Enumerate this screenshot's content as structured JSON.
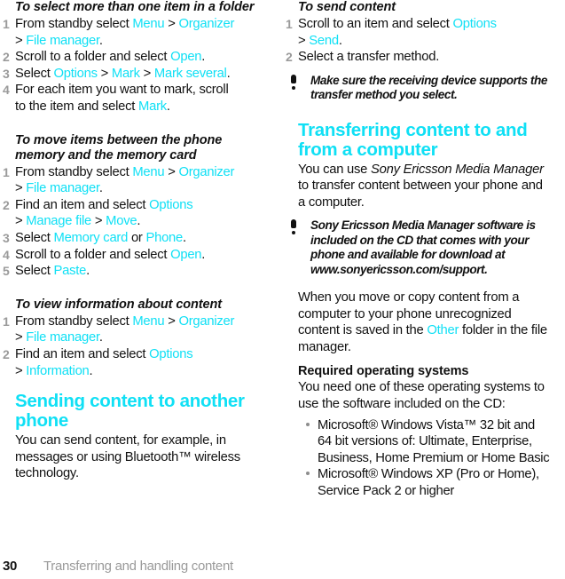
{
  "colors": {
    "accent_cyan": "#10E0F5",
    "step_number_gray": "#9a9a9a",
    "footer_gray": "#9a9a9a",
    "body_black": "#111111"
  },
  "left_column": {
    "proc1": {
      "title": "To select more than one item in a folder",
      "steps": [
        {
          "num": "1",
          "line1_pre": "From standby select ",
          "kw1": "Menu",
          "sep1": " > ",
          "kw2": "Organizer",
          "line2_sep": "> ",
          "kw3": "File manager",
          "line2_end": "."
        },
        {
          "num": "2",
          "pre": "Scroll to a folder and select ",
          "kw1": "Open",
          "end": "."
        },
        {
          "num": "3",
          "pre": "Select ",
          "kw1": "Options",
          "sep1": " > ",
          "kw2": "Mark",
          "sep2": " > ",
          "kw3": "Mark several",
          "end": "."
        },
        {
          "num": "4",
          "line1": "For each item you want to mark, scroll",
          "line2_pre": "to the item and select ",
          "kw1": "Mark",
          "end": "."
        }
      ]
    },
    "proc2": {
      "title": "To move items between the phone memory and the memory card",
      "steps": [
        {
          "num": "1",
          "line1_pre": "From standby select ",
          "kw1": "Menu",
          "sep1": " > ",
          "kw2": "Organizer",
          "line2_sep": "> ",
          "kw3": "File manager",
          "line2_end": "."
        },
        {
          "num": "2",
          "line1_pre": "Find an item and select ",
          "kw1": "Options",
          "line2_sep": "> ",
          "kw2": "Manage file",
          "sep2": " > ",
          "kw3": "Move",
          "line2_end": "."
        },
        {
          "num": "3",
          "pre": "Select ",
          "kw1": "Memory card",
          "sep1": " or ",
          "kw2": "Phone",
          "end": "."
        },
        {
          "num": "4",
          "pre": "Scroll to a folder and select ",
          "kw1": "Open",
          "end": "."
        },
        {
          "num": "5",
          "pre": "Select ",
          "kw1": "Paste",
          "end": "."
        }
      ]
    },
    "proc3": {
      "title": "To view information about content",
      "steps": [
        {
          "num": "1",
          "line1_pre": "From standby select ",
          "kw1": "Menu",
          "sep1": " > ",
          "kw2": "Organizer",
          "line2_sep": "> ",
          "kw3": "File manager",
          "line2_end": "."
        },
        {
          "num": "2",
          "line1_pre": "Find an item and select ",
          "kw1": "Options",
          "line2_sep": "> ",
          "kw2": "Information",
          "line2_end": "."
        }
      ]
    },
    "section": {
      "heading": "Sending content to another phone",
      "body": "You can send content, for example, in messages or using Bluetooth™ wireless technology."
    }
  },
  "right_column": {
    "proc1": {
      "title": "To send content",
      "steps": [
        {
          "num": "1",
          "line1_pre": "Scroll to an item and select ",
          "kw1": "Options",
          "line2_sep": "> ",
          "kw2": "Send",
          "line2_end": "."
        },
        {
          "num": "2",
          "pre": "Select a transfer method.",
          "kw1": "",
          "end": ""
        }
      ]
    },
    "tip1": {
      "icon": "exclamation-icon",
      "text": "Make sure the receiving device supports the transfer method you select."
    },
    "section": {
      "heading": "Transferring content to and from a computer",
      "body_pre": "You can use ",
      "body_italic": "Sony Ericsson Media Manager",
      "body_post": " to transfer content between your phone and a computer."
    },
    "tip2": {
      "icon": "exclamation-icon",
      "text": "Sony Ericsson Media Manager software is included on the CD that comes with your phone and available for download at www.sonyericsson.com/support."
    },
    "para_other": {
      "pre": "When you move or copy content from a computer to your phone unrecognized content is saved in the ",
      "kw": "Other",
      "post": " folder in the file manager."
    },
    "subsection": {
      "heading": "Required operating systems",
      "body": "You need one of these operating systems to use the software included on the CD:",
      "bullets": [
        "Microsoft® Windows Vista™ 32 bit and 64 bit versions of: Ultimate, Enterprise, Business, Home Premium or Home Basic",
        "Microsoft® Windows XP (Pro or Home), Service Pack 2 or higher"
      ]
    }
  },
  "footer": {
    "page_number": "30",
    "chapter": "Transferring and handling content"
  }
}
